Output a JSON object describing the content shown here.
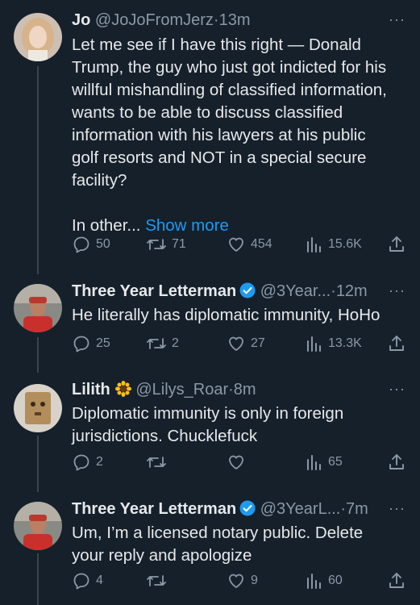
{
  "tweets": [
    {
      "name": "Jo",
      "handle": "@JoJoFromJerz",
      "dot": "·",
      "time": "13m",
      "more": "···",
      "text_lines": [
        "Let me see if I have this right — Donald",
        "Trump, the guy who just got indicted for his",
        "willful mishandling of classified information,",
        "wants to be able to discuss classified",
        "information with his lawyers at his public",
        "golf resorts and NOT in a special secure",
        "facility?"
      ],
      "text_tail": "In other...",
      "show_more": "Show more",
      "replies": "50",
      "retweets": "71",
      "likes": "454",
      "views": "15.6K"
    },
    {
      "name": "Three Year Letterman",
      "handle": "@3Year...",
      "dot": "·",
      "time": "12m",
      "more": "···",
      "text_lines": [
        "He literally has diplomatic immunity, HoHo"
      ],
      "replies": "25",
      "retweets": "2",
      "likes": "27",
      "views": "13.3K"
    },
    {
      "name": "Lilith",
      "name_emoji": "🌻",
      "handle": "@Lilys_Roar",
      "dot": "·",
      "time": "8m",
      "more": "···",
      "text_lines": [
        "Diplomatic immunity is only in foreign",
        "jurisdictions. Chucklefuck"
      ],
      "replies": "2",
      "retweets": "",
      "likes": "",
      "views": "65"
    },
    {
      "name": "Three Year Letterman",
      "handle": "@3YearL...",
      "dot": "·",
      "time": "7m",
      "more": "···",
      "text_lines": [
        "Um, I’m a licensed notary public. Delete",
        "your reply and apologize"
      ],
      "replies": "4",
      "retweets": "",
      "likes": "9",
      "views": "60"
    }
  ],
  "colors": {
    "background": "#15202b",
    "text": "#e7e9ea",
    "muted": "#8b98a5",
    "link": "#1d9bf0",
    "verified": "#1d9bf0",
    "thread_line": "#38444d"
  }
}
